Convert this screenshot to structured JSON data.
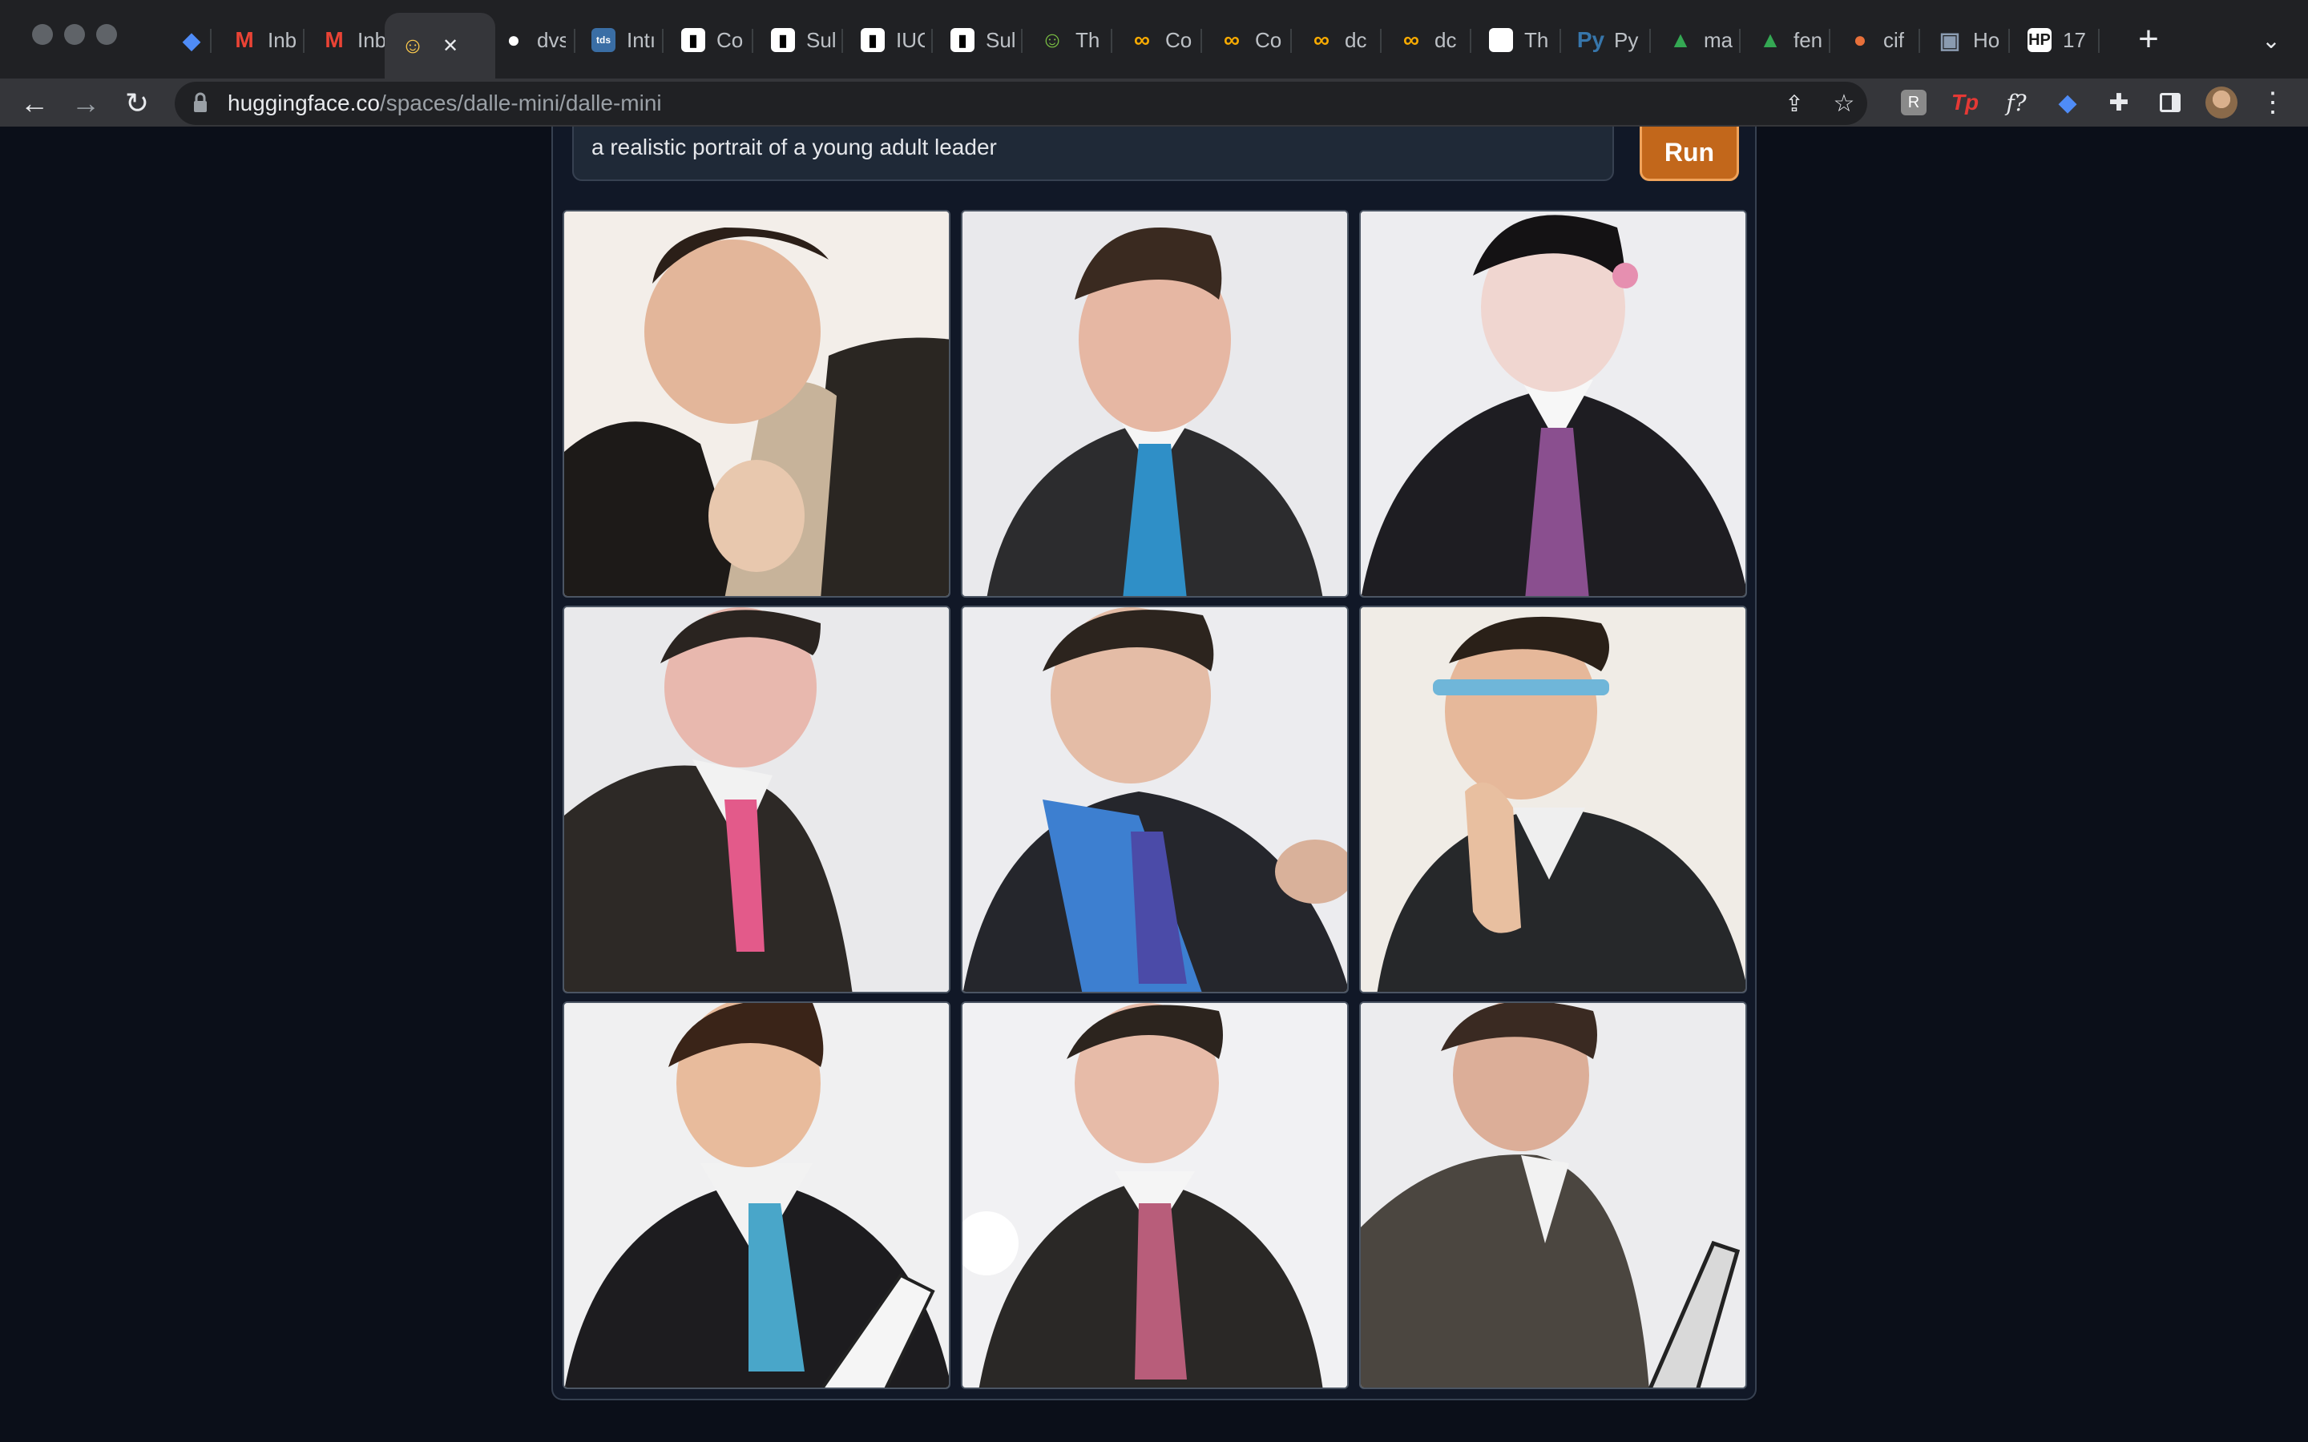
{
  "browser": {
    "tabs": [
      {
        "label": "",
        "icon": "gem-icon",
        "color": "#4f8cf7"
      },
      {
        "label": "Inb",
        "icon": "gmail-icon",
        "color": "#ea4335"
      },
      {
        "label": "Inb",
        "icon": "gmail-icon",
        "color": "#ea4335"
      },
      {
        "label": "",
        "icon": "hugging-face-icon",
        "color": "#ffcc4d",
        "active": true
      },
      {
        "label": "dvs",
        "icon": "github-icon",
        "color": "#ffffff"
      },
      {
        "label": "Intı",
        "icon": "tds-icon",
        "color": "#3a6ea5"
      },
      {
        "label": "Co",
        "icon": "notion-icon",
        "color": "#000000"
      },
      {
        "label": "Sul",
        "icon": "notion-icon",
        "color": "#000000"
      },
      {
        "label": "IUC",
        "icon": "notion-icon",
        "color": "#000000"
      },
      {
        "label": "Sul",
        "icon": "notion-icon",
        "color": "#000000"
      },
      {
        "label": "Th",
        "icon": "emoji-icon",
        "color": "#7bc043"
      },
      {
        "label": "Co",
        "icon": "colab-icon",
        "color": "#f9ab00"
      },
      {
        "label": "Co",
        "icon": "colab-icon",
        "color": "#f9ab00"
      },
      {
        "label": "dc",
        "icon": "colab-icon",
        "color": "#f9ab00"
      },
      {
        "label": "dc",
        "icon": "colab-icon",
        "color": "#f9ab00"
      },
      {
        "label": "Th",
        "icon": "newspaper-icon",
        "color": "#ffffff"
      },
      {
        "label": "Py",
        "icon": "python-icon",
        "color": "#3776ab"
      },
      {
        "label": "ma",
        "icon": "drive-icon",
        "color": "#34a853"
      },
      {
        "label": "fen",
        "icon": "drive-icon",
        "color": "#34a853"
      },
      {
        "label": "cif",
        "icon": "circle-icon",
        "color": "#e8703a"
      },
      {
        "label": "Ho",
        "icon": "photo-icon",
        "color": "#8a9bb0"
      },
      {
        "label": "17",
        "icon": "hp-icon",
        "color": "#1a1a1a"
      }
    ],
    "url_domain": "huggingface.co",
    "url_path": "/spaces/dalle-mini/dalle-mini"
  },
  "app": {
    "prompt_text": "a realistic portrait of a young adult leader",
    "run_label": "Run"
  }
}
